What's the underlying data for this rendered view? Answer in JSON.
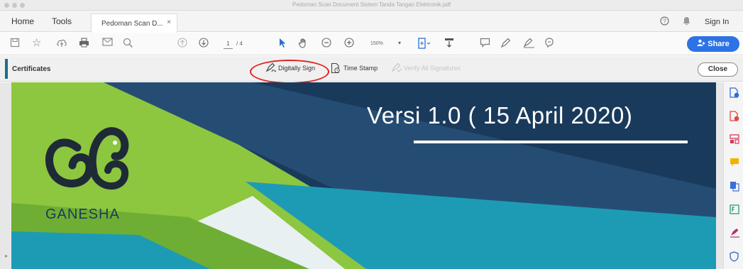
{
  "window": {
    "title": "Pedoman Scan Document Sistem Tanda Tangan Elektronik.pdf"
  },
  "tabbar": {
    "home_label": "Home",
    "tools_label": "Tools",
    "document_tab_label": "Pedoman Scan D...",
    "document_tab_close": "×",
    "help_icon": "help-icon",
    "notifications_icon": "bell-icon",
    "signin_label": "Sign In"
  },
  "toolbar": {
    "page_current": "1",
    "page_total": "/ 4",
    "zoom_value": "150%",
    "share_label": "Share",
    "icons": [
      "save-icon",
      "bookmark-star-icon",
      "upload-icon",
      "print-icon",
      "email-icon",
      "search-icon",
      "page-up-icon",
      "page-down-icon",
      "select-cursor-icon",
      "hand-icon",
      "zoom-out-icon",
      "zoom-in-icon",
      "fit-page-icon",
      "scroll-mode-icon",
      "comment-icon",
      "highlight-pen-icon",
      "sign-icon",
      "stamp-icon"
    ],
    "accent_color": "#2d73e6"
  },
  "certificates_bar": {
    "title": "Certificates",
    "digitally_sign_label": "Digitally Sign",
    "time_stamp_label": "Time Stamp",
    "verify_all_label": "Verify All Signatures",
    "close_label": "Close",
    "highlight_color": "#e02424"
  },
  "document": {
    "slide_title": "Versi 1.0 ( 15 April 2020)",
    "brand_name": "GANESHA",
    "colors": {
      "navy": "#1a3a5c",
      "lime": "#8dc63f",
      "teal": "#1d9bb5"
    }
  },
  "right_rail": {
    "icons": [
      {
        "name": "export-pdf-icon",
        "color": "#2a6fd6"
      },
      {
        "name": "create-pdf-icon",
        "color": "#e04a3c"
      },
      {
        "name": "organize-pages-icon",
        "color": "#d9365e"
      },
      {
        "name": "comment-tool-icon",
        "color": "#f0b400"
      },
      {
        "name": "combine-files-icon",
        "color": "#3b6fd6"
      },
      {
        "name": "edit-pdf-icon",
        "color": "#2f9e6b"
      },
      {
        "name": "fill-sign-icon",
        "color": "#b0326e"
      },
      {
        "name": "protect-icon",
        "color": "#3564c8"
      }
    ]
  }
}
